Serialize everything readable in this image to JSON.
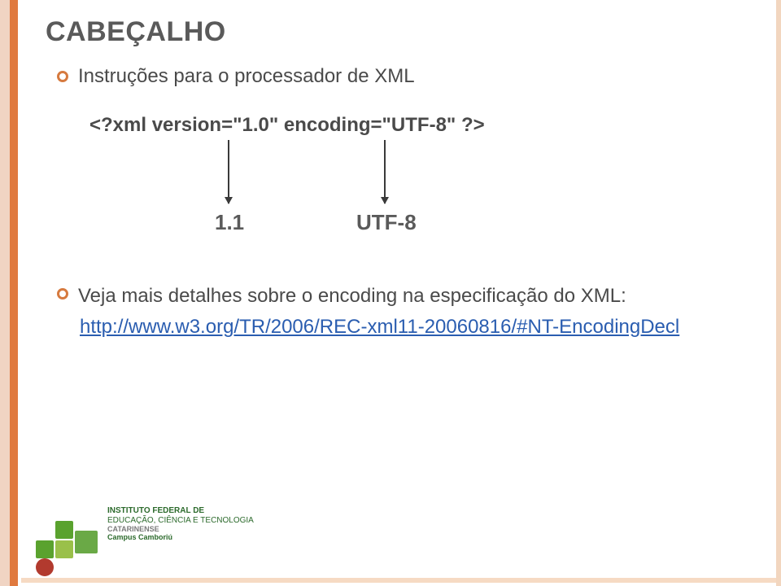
{
  "title": "CABEÇALHO",
  "bullets": {
    "intro": "Instruções para o processador de XML",
    "details": "Veja mais detalhes sobre o encoding na especificação do XML:"
  },
  "code": "<?xml version=\"1.0\" encoding=\"UTF-8\" ?>",
  "arrows": {
    "version_label": "1.1",
    "encoding_label": "UTF-8"
  },
  "link": "http://www.w3.org/TR/2006/REC-xml11-20060816/#NT-EncodingDecl",
  "logo": {
    "line1": "INSTITUTO FEDERAL DE",
    "line2": "EDUCAÇÃO, CIÊNCIA E TECNOLOGIA",
    "line3": "CATARINENSE",
    "line4": "Campus Camboriú"
  }
}
